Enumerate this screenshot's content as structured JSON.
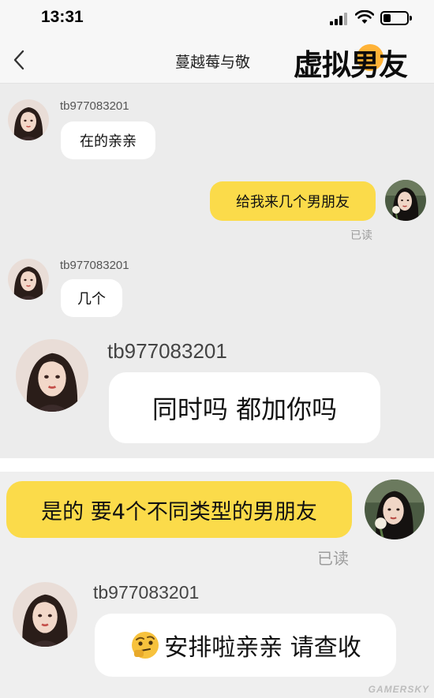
{
  "status_bar": {
    "time": "13:31"
  },
  "nav": {
    "title": "蔓越莓与敬",
    "overlay_title": "虚拟男友"
  },
  "messages": [
    {
      "sender": "tb977083201",
      "text": "在的亲亲"
    },
    {
      "text": "给我来几个男朋友",
      "status": "已读"
    },
    {
      "sender": "tb977083201",
      "text": "几个"
    },
    {
      "sender": "tb977083201",
      "text": "同时吗 都加你吗"
    },
    {
      "text": "是的 要4个不同类型的男朋友",
      "status": "已读"
    },
    {
      "sender": "tb977083201",
      "text": "安排啦亲亲 请查收",
      "emoji": "thinking-face-icon"
    }
  ],
  "watermark": "GAMERSKY",
  "colors": {
    "outgoing_bubble": "#fbdb4a",
    "incoming_bubble": "#ffffff",
    "background": "#ececec",
    "overlay_accent": "#ffb338"
  }
}
